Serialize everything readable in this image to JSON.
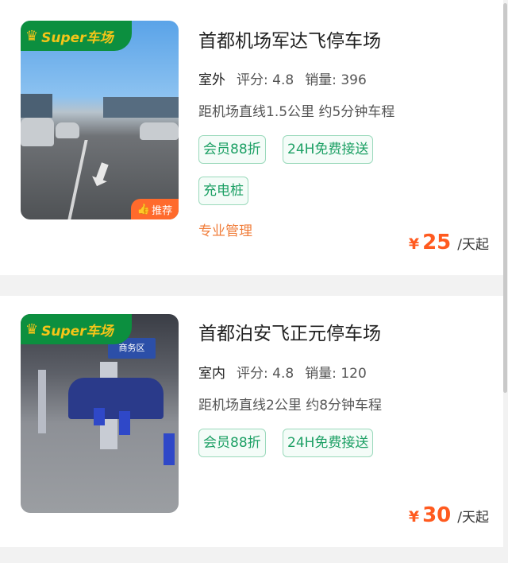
{
  "lots": [
    {
      "brand_badge": "Super车场",
      "recommend_badge": "推荐",
      "title": "首都机场军达飞停车场",
      "environment": "室外",
      "rating_label": "评分:",
      "rating_value": "4.8",
      "sales_label": "销量:",
      "sales_value": "396",
      "distance": "距机场直线1.5公里 约5分钟车程",
      "tags": [
        "会员88折",
        "24H免费接送",
        "充电桩"
      ],
      "management": "专业管理",
      "currency": "¥",
      "price": "25",
      "price_unit": "/天起"
    },
    {
      "brand_badge": "Super车场",
      "title": "首都泊安飞正元停车场",
      "environment": "室内",
      "rating_label": "评分:",
      "rating_value": "4.8",
      "sales_label": "销量:",
      "sales_value": "120",
      "distance": "距机场直线2公里 约8分钟车程",
      "tags": [
        "会员88折",
        "24H免费接送"
      ],
      "image_sign": "商务区",
      "currency": "¥",
      "price": "30",
      "price_unit": "/天起"
    }
  ],
  "colors": {
    "brand_green": "#0c8f3f",
    "tag_green": "#1da065",
    "price_orange": "#ff5a1f",
    "recommend_orange": "#ff6a2c",
    "management_orange": "#f07d3a"
  }
}
